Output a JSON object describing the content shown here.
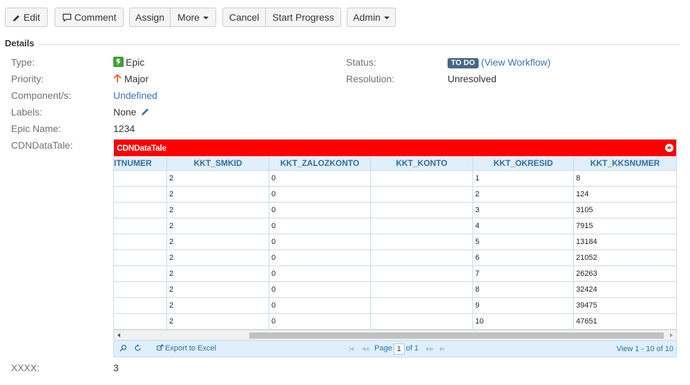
{
  "toolbar": {
    "edit": "Edit",
    "comment": "Comment",
    "assign": "Assign",
    "more": "More",
    "cancel": "Cancel",
    "start_progress": "Start Progress",
    "admin": "Admin"
  },
  "details": {
    "title": "Details",
    "type_label": "Type:",
    "type_value": "Epic",
    "priority_label": "Priority:",
    "priority_value": "Major",
    "components_label": "Component/s:",
    "components_value": "Undefined",
    "labels_label": "Labels:",
    "labels_value": "None",
    "epic_name_label": "Epic Name:",
    "epic_name_value": "1234",
    "cdn_label": "CDNDataTale:",
    "status_label": "Status:",
    "status_value": "TO DO",
    "view_workflow": "(View Workflow)",
    "resolution_label": "Resolution:",
    "resolution_value": "Unresolved",
    "xxxx_label": "XXXX:",
    "xxxx_value": "3"
  },
  "grid": {
    "title": "CDNDataTale",
    "columns": [
      "ITNUMER",
      "KKT_SMKID",
      "KKT_ZALOZKONTO",
      "KKT_KONTO",
      "KKT_OKRESID",
      "KKT_KKSNUMER"
    ],
    "rows": [
      [
        "",
        "2",
        "0",
        "",
        "1",
        "8"
      ],
      [
        "",
        "2",
        "0",
        "",
        "2",
        "124"
      ],
      [
        "",
        "2",
        "0",
        "",
        "3",
        "3105"
      ],
      [
        "",
        "2",
        "0",
        "",
        "4",
        "7915"
      ],
      [
        "",
        "2",
        "0",
        "",
        "5",
        "13184"
      ],
      [
        "",
        "2",
        "0",
        "",
        "6",
        "21052"
      ],
      [
        "",
        "2",
        "0",
        "",
        "7",
        "26263"
      ],
      [
        "",
        "2",
        "0",
        "",
        "8",
        "32424"
      ],
      [
        "",
        "2",
        "0",
        "",
        "9",
        "39475"
      ],
      [
        "",
        "2",
        "0",
        "",
        "10",
        "47651"
      ]
    ],
    "export_label": "Export to Excel",
    "page_label": "Page",
    "page_value": "1",
    "of_label": "of 1",
    "view_text": "View 1 - 10 of 10"
  }
}
